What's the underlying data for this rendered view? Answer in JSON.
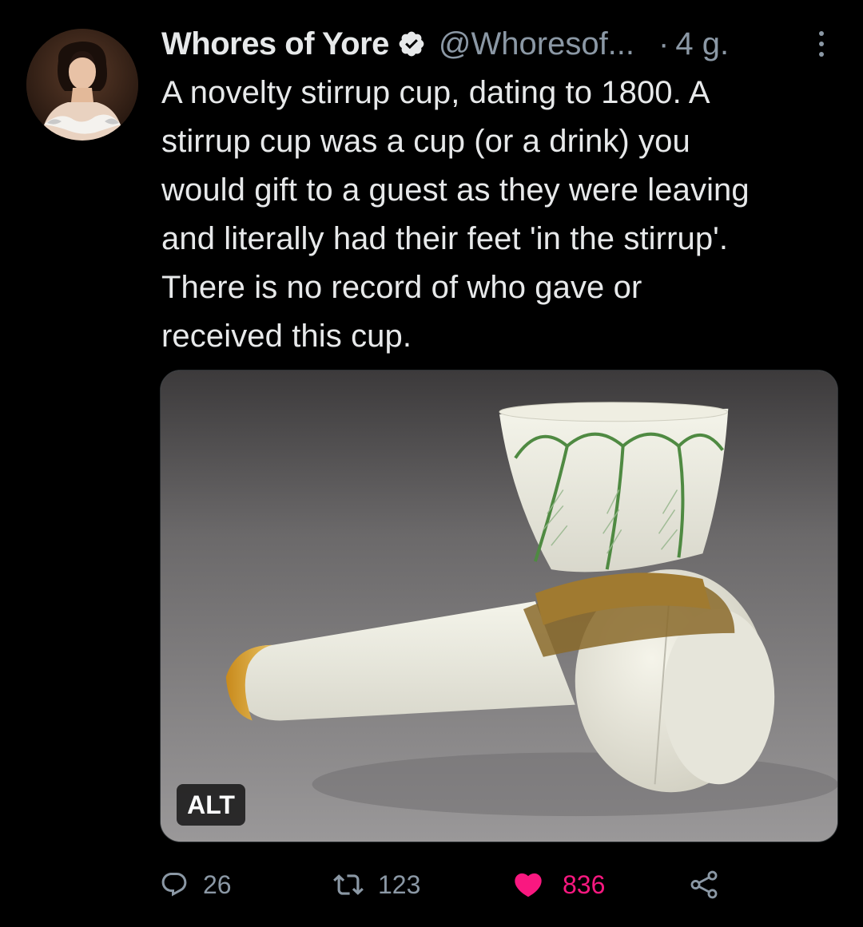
{
  "tweet": {
    "display_name": "Whores of Yore",
    "handle": "@Whoresof...",
    "separator": "·",
    "time": "4 g.",
    "text": "A novelty stirrup cup, dating to 1800. A\nstirrup cup was a cup (or a drink) you\nwould gift to a guest as they were leaving\nand literally had their feet 'in the stirrup'.\nThere is no record of who gave or\nreceived this cup.",
    "media_alt_badge": "ALT"
  },
  "actions": {
    "reply_count": "26",
    "retweet_count": "123",
    "like_count": "836"
  },
  "icons": {
    "verified": "verified-badge-icon",
    "more": "more-options-icon",
    "reply": "reply-icon",
    "retweet": "retweet-icon",
    "like": "heart-icon",
    "share": "share-icon"
  },
  "colors": {
    "background": "#000000",
    "text": "#e7e9ea",
    "secondary": "#8b98a5",
    "like": "#f91880"
  }
}
